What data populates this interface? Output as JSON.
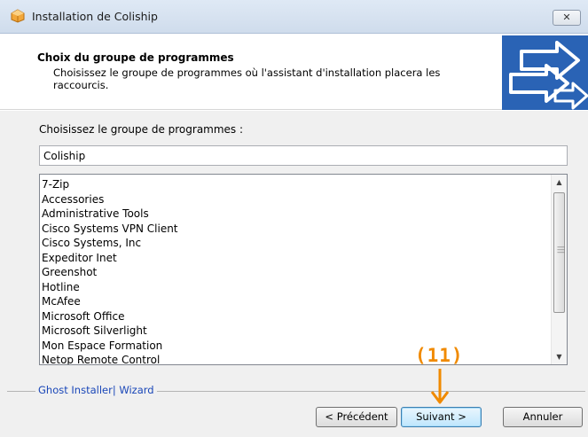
{
  "window": {
    "title": "Installation de Coliship",
    "close_label": "✕"
  },
  "header": {
    "title": "Choix du groupe de programmes",
    "description": "Choisissez le groupe de programmes où l'assistant d'installation placera les raccourcis."
  },
  "main": {
    "prompt": "Choisissez le groupe de programmes :",
    "group_value": "Coliship",
    "program_groups": [
      "7-Zip",
      "Accessories",
      "Administrative Tools",
      "Cisco Systems VPN Client",
      "Cisco Systems, Inc",
      "Expeditor Inet",
      "Greenshot",
      "Hotline",
      "McAfee",
      "Microsoft Office",
      "Microsoft Silverlight",
      "Mon Espace Formation",
      "Netop Remote Control"
    ],
    "scroll_position": 0.0
  },
  "footer": {
    "brand": "Ghost Installer| Wizard",
    "prev_label": "< Précédent",
    "next_label": "Suivant >",
    "cancel_label": "Annuler"
  },
  "annotation": {
    "label": "(11)",
    "color": "#f08a00"
  },
  "colors": {
    "title_bar": "#d6e2f0",
    "brand_link": "#1a47b8",
    "panel_bg": "#f0f0f0"
  }
}
